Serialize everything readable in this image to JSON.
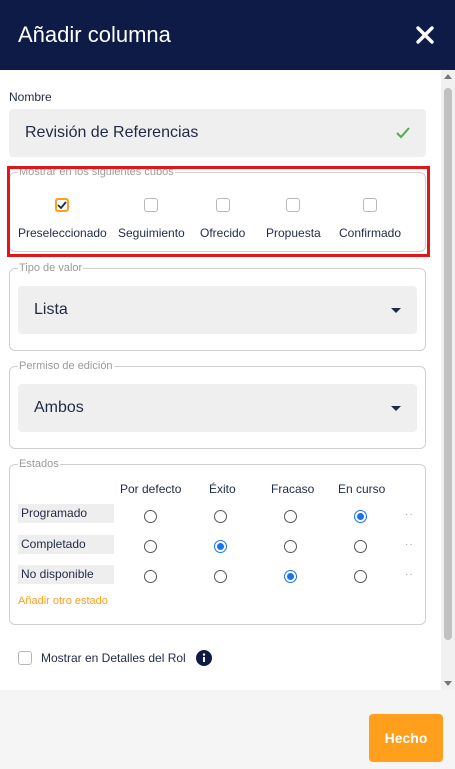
{
  "header": {
    "title": "Añadir columna"
  },
  "name": {
    "label": "Nombre",
    "value": "Revisión de Referencias"
  },
  "cubes": {
    "legend": "Mostrar en los siguientes cubos",
    "items": [
      {
        "label": "Preseleccionado",
        "checked": true
      },
      {
        "label": "Seguimiento",
        "checked": false
      },
      {
        "label": "Ofrecido",
        "checked": false
      },
      {
        "label": "Propuesta",
        "checked": false
      },
      {
        "label": "Confirmado",
        "checked": false
      }
    ]
  },
  "value_type": {
    "legend": "Tipo de valor",
    "selected": "Lista"
  },
  "edit_permission": {
    "legend": "Permiso de edición",
    "selected": "Ambos"
  },
  "states": {
    "legend": "Estados",
    "columns": [
      "Por defecto",
      "Éxito",
      "Fracaso",
      "En curso"
    ],
    "rows": [
      {
        "label": "Programado",
        "selected": 3
      },
      {
        "label": "Completado",
        "selected": 1
      },
      {
        "label": "No disponible",
        "selected": 2
      }
    ],
    "add_link": "Añadir otro estado"
  },
  "show_role": {
    "label": "Mostrar en Detalles del Rol",
    "checked": false
  },
  "footer": {
    "done_label": "Hecho"
  },
  "colors": {
    "header": "#0d1b46",
    "accent": "#ff9f1c",
    "highlight": "#e0161b",
    "radio": "#1a73e8"
  }
}
